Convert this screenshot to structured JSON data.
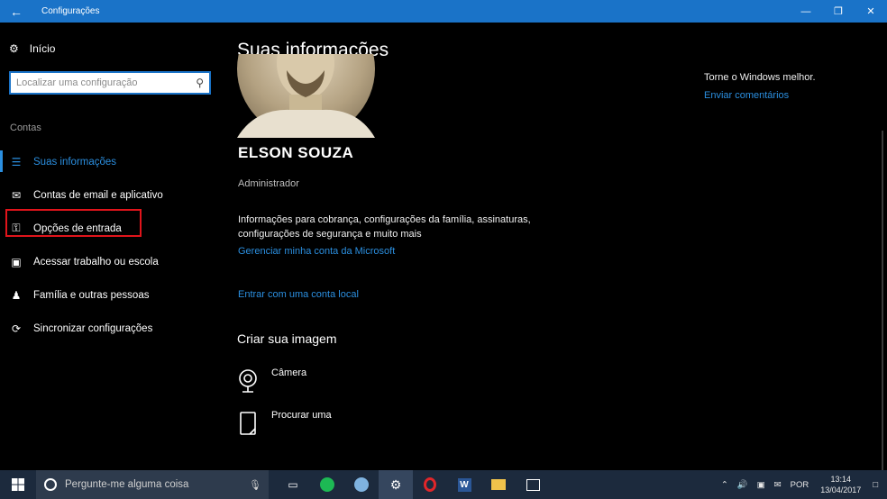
{
  "titlebar": {
    "title": "Configurações"
  },
  "sidebar": {
    "home_label": "Início",
    "search_placeholder": "Localizar uma configuração",
    "section_label": "Contas",
    "items": [
      {
        "label": "Suas informações",
        "icon": "user-info-icon"
      },
      {
        "label": "Contas de email e aplicativo",
        "icon": "mail-icon"
      },
      {
        "label": "Opções de entrada",
        "icon": "key-icon"
      },
      {
        "label": "Acessar trabalho ou escola",
        "icon": "briefcase-icon"
      },
      {
        "label": "Família e outras pessoas",
        "icon": "person-icon"
      },
      {
        "label": "Sincronizar configurações",
        "icon": "sync-icon"
      }
    ]
  },
  "main": {
    "title": "Suas informações",
    "user_name": "ELSON SOUZA",
    "role": "Administrador",
    "info_text": "Informações para cobrança, configurações da família, assinaturas, configurações de segurança e muito mais",
    "manage_link": "Gerenciar minha conta da Microsoft",
    "local_link": "Entrar com uma conta local",
    "create_title": "Criar sua imagem",
    "camera_label": "Câmera",
    "browse_label": "Procurar uma"
  },
  "right": {
    "title": "Torne o Windows melhor.",
    "feedback_link": "Enviar comentários"
  },
  "taskbar": {
    "cortana_placeholder": "Pergunte-me alguma coisa",
    "language": "POR",
    "time": "13:14",
    "date": "13/04/2017"
  },
  "colors": {
    "accent": "#1a73c8",
    "link": "#2b8fe0",
    "highlight": "#e0141b",
    "taskbar": "#1c2a3d"
  }
}
